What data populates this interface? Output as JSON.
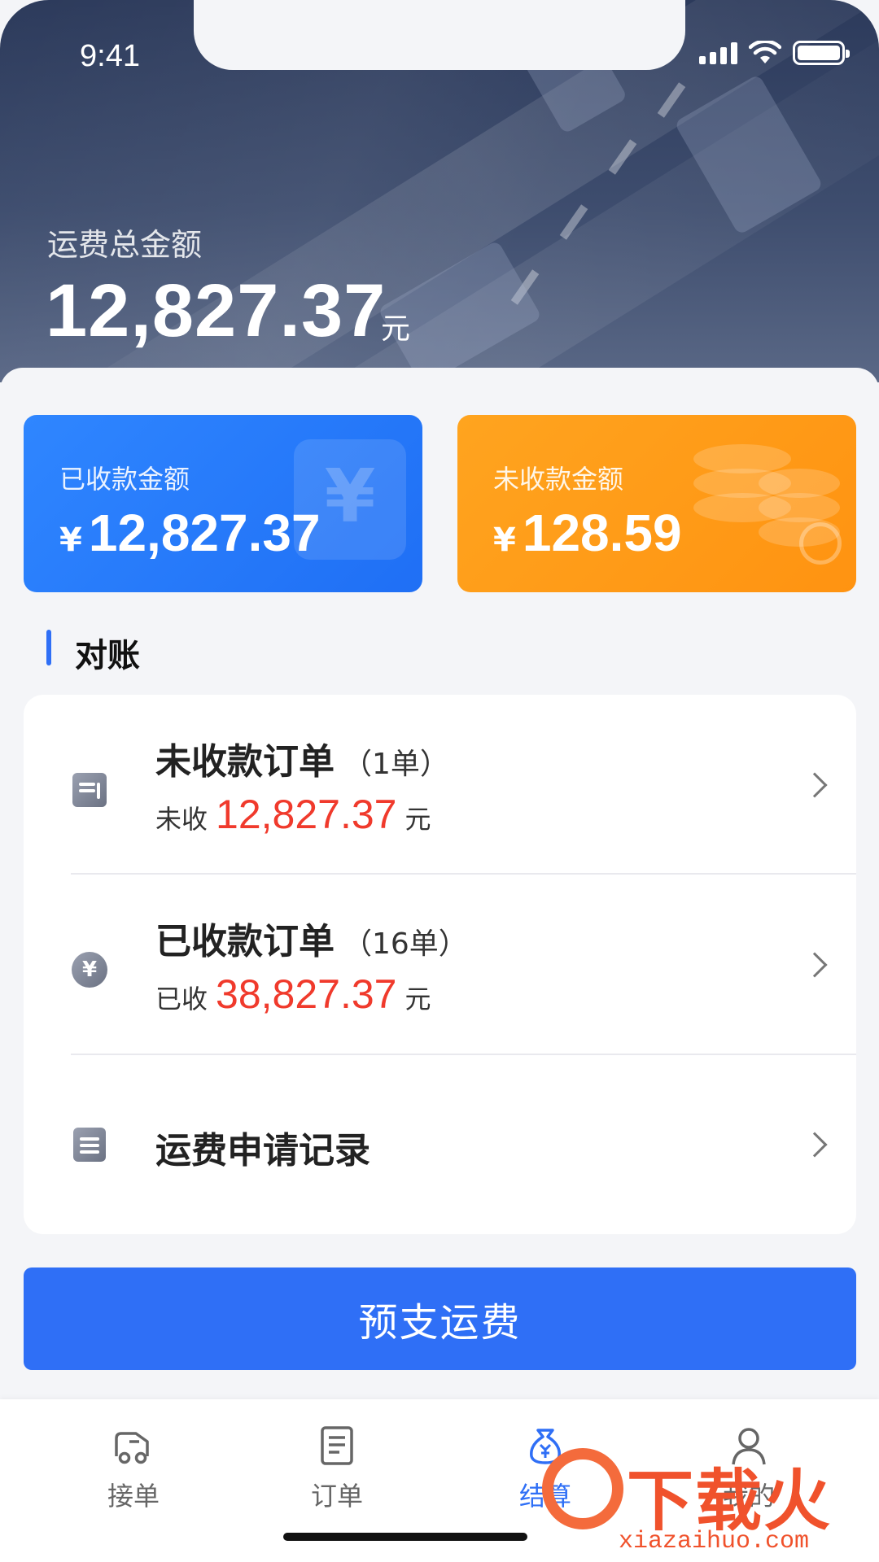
{
  "status_bar": {
    "time": "9:41"
  },
  "hero": {
    "label": "运费总金额",
    "amount": "12,827.37",
    "unit": "元"
  },
  "cards": {
    "received": {
      "label": "已收款金额",
      "currency": "¥",
      "amount": "12,827.37"
    },
    "unreceived": {
      "label": "未收款金额",
      "currency": "¥",
      "amount": "128.59"
    }
  },
  "section": {
    "title": "对账"
  },
  "list": {
    "unpaid": {
      "title": "未收款订单",
      "count": "（1单）",
      "sub_prefix": "未收",
      "amount": "12,827.37",
      "unit": "元"
    },
    "paid": {
      "title": "已收款订单",
      "count": "（16单）",
      "sub_prefix": "已收",
      "amount": "38,827.37",
      "unit": "元"
    },
    "records": {
      "title": "运费申请记录"
    }
  },
  "primary_button": {
    "label": "预支运费"
  },
  "tabbar": {
    "tabs": [
      {
        "label": "接单",
        "icon": "truck-icon"
      },
      {
        "label": "订单",
        "icon": "document-icon"
      },
      {
        "label": "结算",
        "icon": "money-bag-icon"
      },
      {
        "label": "我的",
        "icon": "user-icon"
      }
    ]
  },
  "watermark": {
    "brand": "下载火",
    "domain": "xiazaihuo.com"
  },
  "colors": {
    "accent": "#2f6ff6",
    "orange": "#ff9a17",
    "red": "#f03a2c"
  }
}
